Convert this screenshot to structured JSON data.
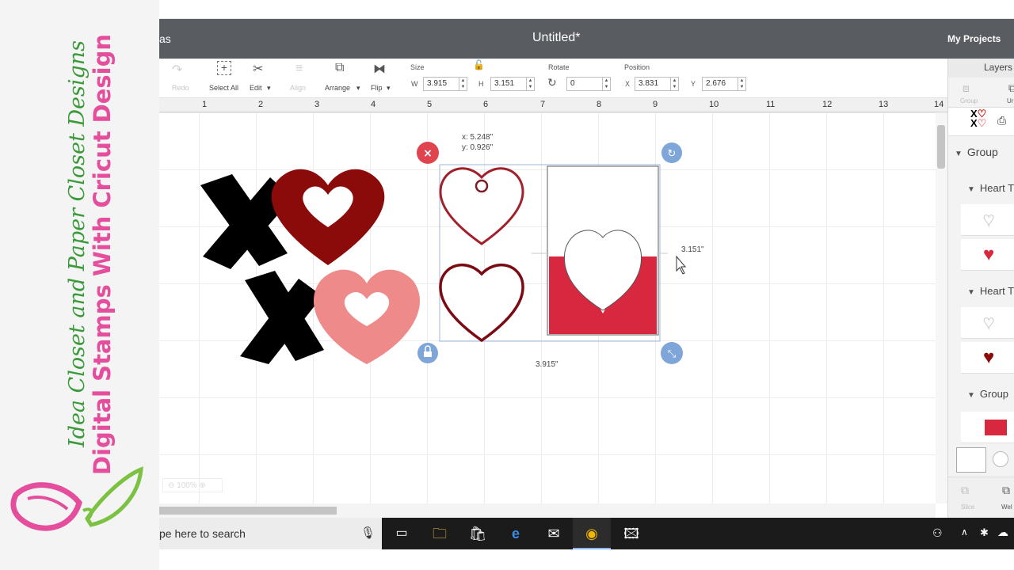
{
  "watermark": {
    "line1": "Idea Closet and Paper Closet Designs",
    "line2": "Digital Stamps With Cricut Design"
  },
  "header": {
    "left_fragment": "as",
    "title": "Untitled*",
    "my_projects": "My Projects"
  },
  "toolbar": {
    "redo": "Redo",
    "select_all": "Select All",
    "edit": "Edit",
    "align": "Align",
    "arrange": "Arrange",
    "flip": "Flip",
    "size_label": "Size",
    "w_label": "W",
    "w_value": "3.915",
    "h_label": "H",
    "h_value": "3.151",
    "rotate_label": "Rotate",
    "rotate_value": "0",
    "position_label": "Position",
    "x_label": "X",
    "x_value": "3.831",
    "y_label": "Y",
    "y_value": "2.676"
  },
  "ruler": [
    "1",
    "2",
    "3",
    "4",
    "5",
    "6",
    "7",
    "8",
    "9",
    "10",
    "11",
    "12",
    "13",
    "14"
  ],
  "canvas": {
    "coord_x": "x: 5.248\"",
    "coord_y": "y: 0.926\"",
    "height_dim": "3.151\"",
    "width_dim": "3.915\"",
    "zoom": "100%"
  },
  "layers": {
    "title": "Layers",
    "group_btn": "Group",
    "ungroup_btn": "Ur",
    "group1": "Group",
    "heart1": "Heart T",
    "heart2": "Heart T",
    "group2": "Group",
    "slice": "Slice",
    "weld": "Wel"
  },
  "taskbar": {
    "search": "pe here to search"
  },
  "colors": {
    "header_bg": "#595c61",
    "dark_red": "#8b0a0a",
    "pink": "#ef8a8a",
    "red": "#d8283f",
    "handle_blue": "#7fa6d8",
    "delete_red": "#e0454f"
  }
}
